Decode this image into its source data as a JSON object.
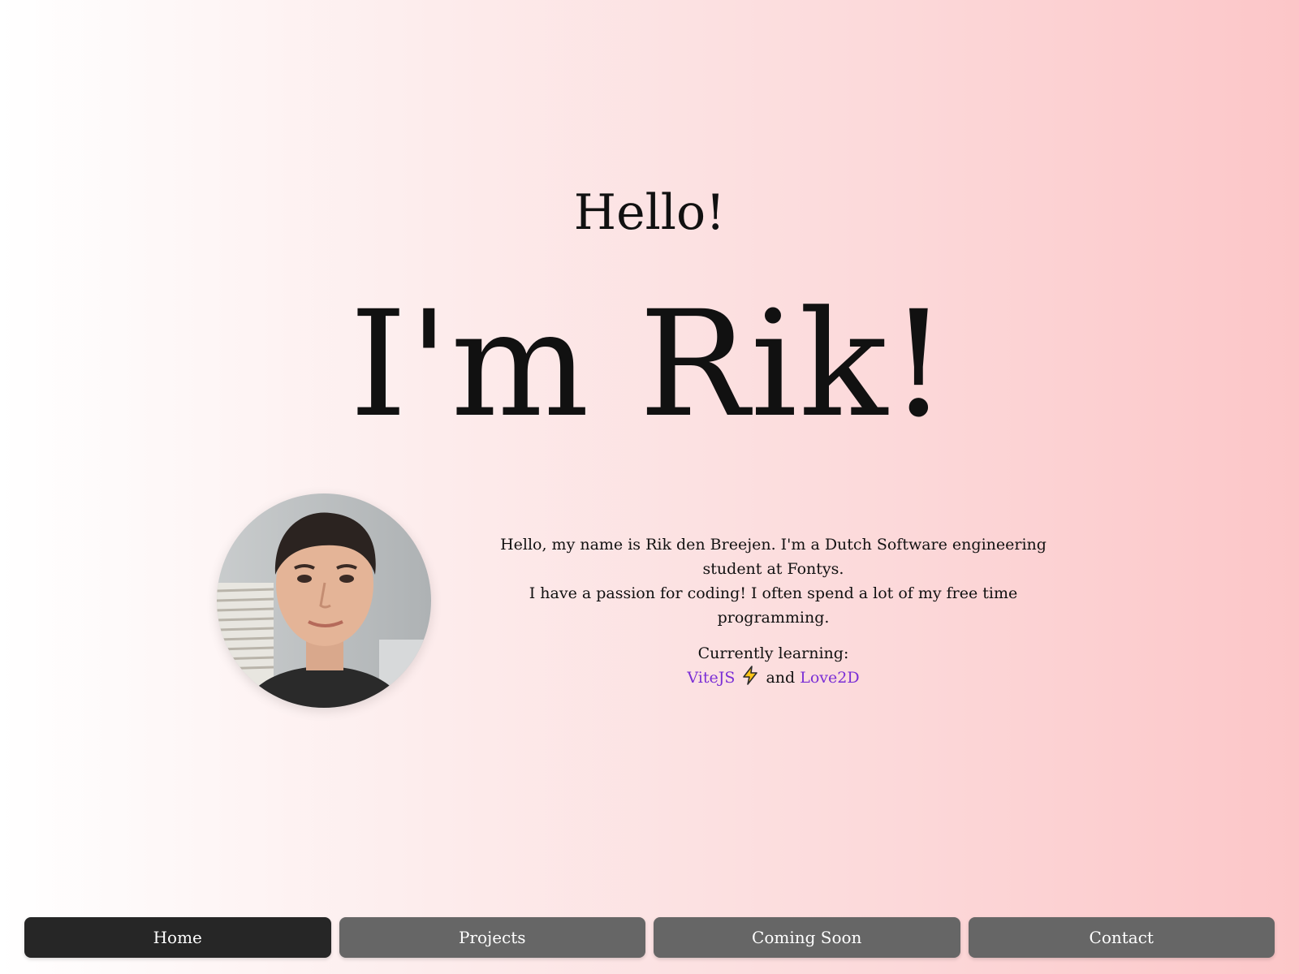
{
  "hero": {
    "greeting": "Hello!",
    "name": "I'm Rik!"
  },
  "profile": {
    "avatar_icon": "profile-photo"
  },
  "bio": {
    "line1": "Hello, my name is Rik den Breejen. I'm a Dutch Software engineering student at Fontys.",
    "line2": "I have a passion for coding! I often spend a lot of my free time programming.",
    "learning_label": "Currently learning:",
    "link1": "ViteJS",
    "link1_icon": "lightning-bolt-icon",
    "connector": "and",
    "link2": "Love2D",
    "link_color": "#7b2fd6"
  },
  "nav": {
    "items": [
      {
        "label": "Home",
        "active": true
      },
      {
        "label": "Projects",
        "active": false
      },
      {
        "label": "Coming Soon",
        "active": false
      },
      {
        "label": "Contact",
        "active": false
      }
    ],
    "active_color": "#262626",
    "inactive_color": "#666666"
  }
}
